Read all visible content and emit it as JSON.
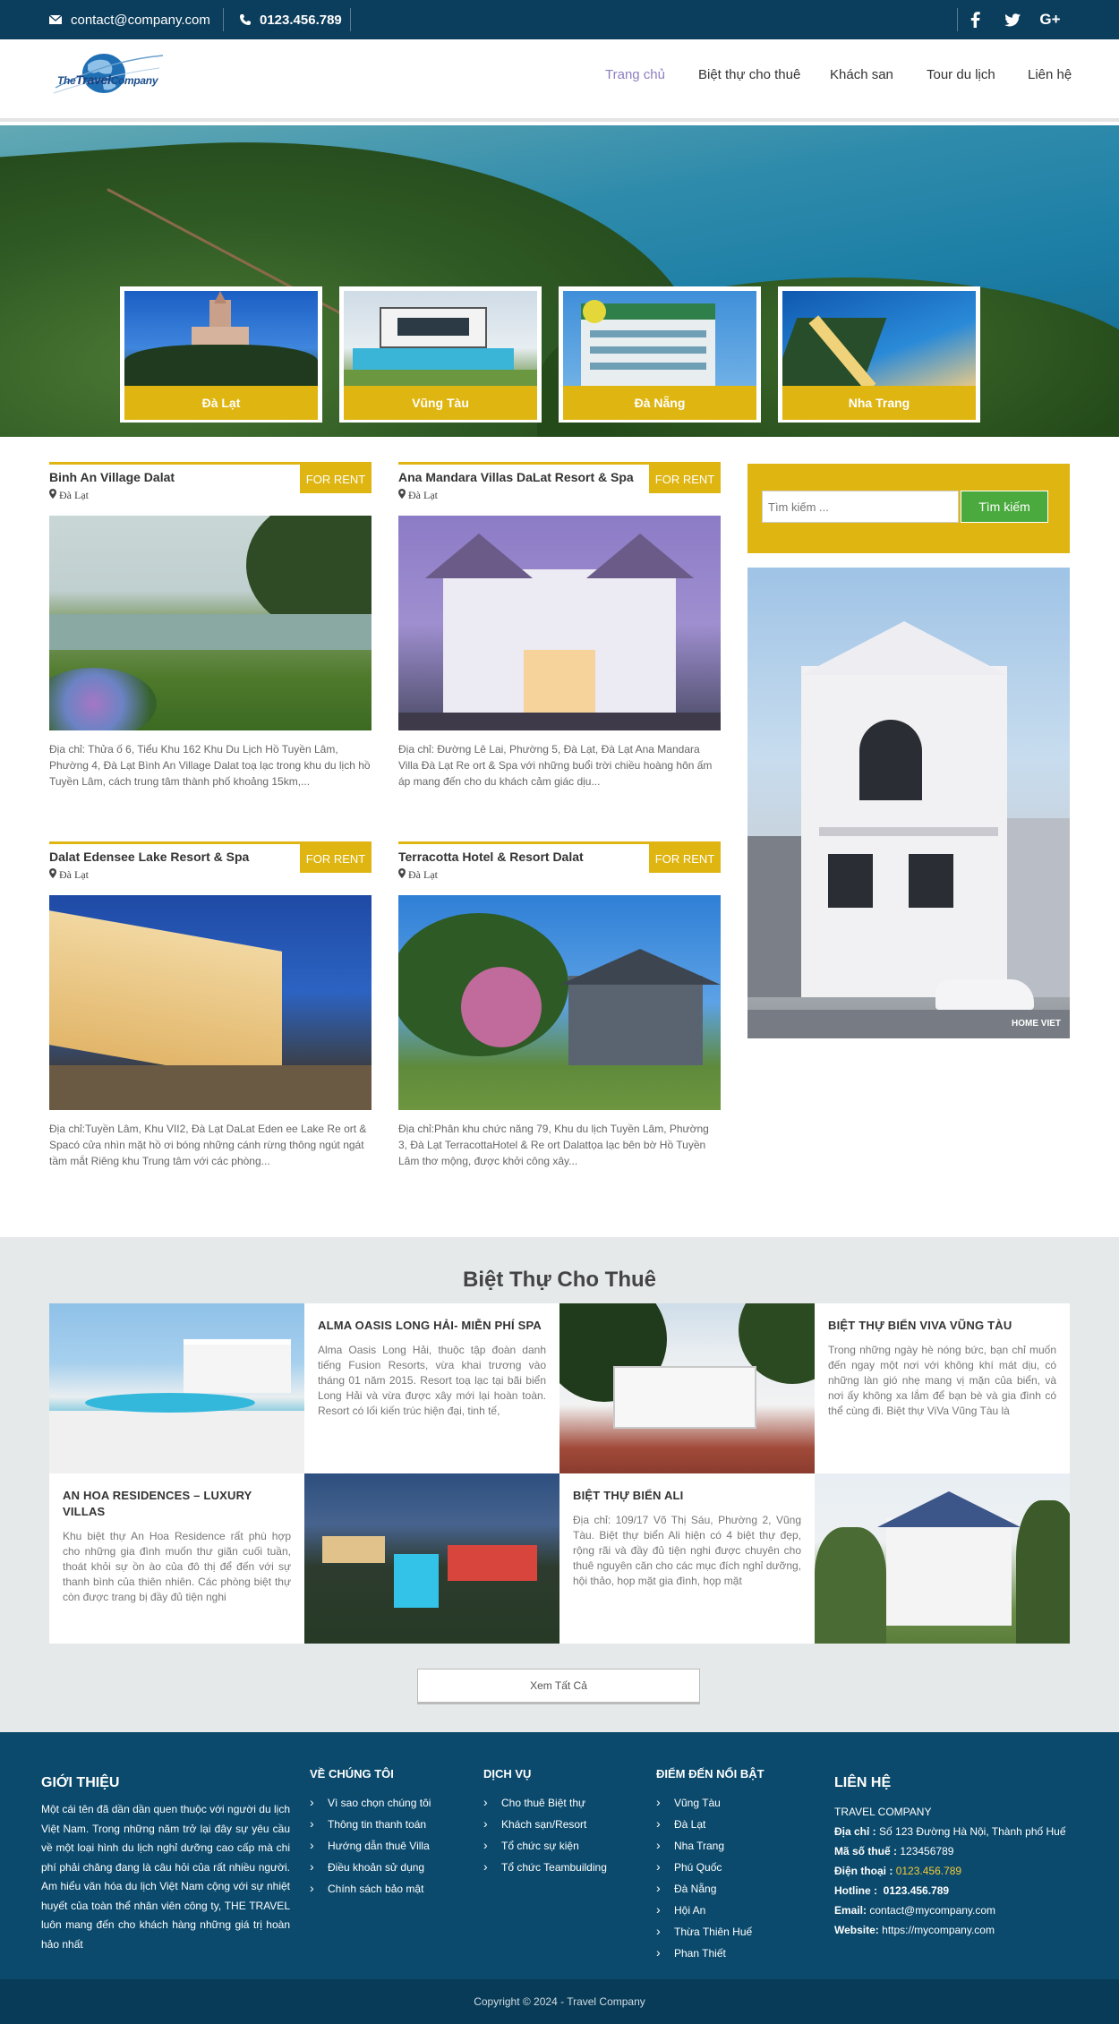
{
  "topbar": {
    "email": "contact@company.com",
    "phone": "0123.456.789",
    "social": {
      "facebook": "f",
      "twitter": "t",
      "google_plus": "G+"
    }
  },
  "header": {
    "logo_text_1": "The",
    "logo_text_2": "Travel",
    "logo_text_3": "Company",
    "nav": [
      "Trang chủ",
      "Biệt thự cho thuê",
      "Khách san",
      "Tour du lịch",
      "Liên hệ"
    ]
  },
  "destinations": [
    "Đà Lạt",
    "Vũng Tàu",
    "Đà Nẵng",
    "Nha Trang"
  ],
  "listings": [
    {
      "title": "Binh An Village Dalat",
      "location": "Đà Lạt",
      "badge": "FOR RENT",
      "desc": "Địa chỉ: Thửa ố 6, Tiểu Khu 162 Khu Du Lịch Hồ Tuyền Lâm, Phường 4, Đà Lạt Bình An Village Dalat toạ lạc trong khu du lịch hồ Tuyền Lâm, cách trung tâm thành phố khoảng 15km,..."
    },
    {
      "title": "Ana Mandara Villas DaLat Resort & Spa",
      "location": "Đà Lạt",
      "badge": "FOR RENT",
      "desc": "Địa chỉ: Đường Lê Lai, Phường 5, Đà Lạt, Đà Lạt Ana Mandara Villa Đà Lạt Re ort & Spa với những buổi trời chiều hoàng hôn ấm áp mang đến cho du khách cảm giác dịu..."
    },
    {
      "title": "Dalat Edensee Lake Resort & Spa",
      "location": "Đà Lạt",
      "badge": "FOR RENT",
      "desc": "Địa chỉ:Tuyền Lâm, Khu VII2, Đà Lạt DaLat Eden ee Lake Re ort & Spacó cửa nhìn mặt hồ ơi bóng những cánh rừng thông ngút ngát tầm mắt Riêng khu Trung tâm với các phòng..."
    },
    {
      "title": "Terracotta Hotel & Resort Dalat",
      "location": "Đà Lạt",
      "badge": "FOR RENT",
      "desc": "Địa chỉ:Phân khu chức năng 79, Khu du lịch Tuyền Lâm, Phường 3, Đà Lạt TerracottaHotel & Re ort Dalattọa lạc bên bờ Hồ Tuyền Lâm thơ mộng, được khởi công xây..."
    }
  ],
  "sidebar": {
    "search_placeholder": "Tìm kiếm ...",
    "search_button": "Tìm kiếm",
    "image_watermark": "HOME VIET"
  },
  "villas": {
    "title": "Biệt Thự Cho Thuê",
    "items": [
      {
        "title": "ALMA OASIS LONG HẢI- MIỄN PHÍ SPA",
        "desc": "Alma Oasis Long Hải, thuộc tập đoàn danh tiếng Fusion Resorts, vừa khai trương vào tháng 01 năm 2015. Resort toạ lạc tại bãi biển Long Hải và vừa được xây mới lại hoàn toàn. Resort có lối kiến trúc hiện đại, tinh tế,"
      },
      {
        "title": "BIỆT THỰ BIỂN VIVA VŨNG TÀU",
        "desc": "Trong những ngày hè nóng bức, bạn chỉ muốn đến ngay một nơi với không khí mát dịu, có những làn gió nhẹ mang vị mặn của biển, và nơi ấy không xa lắm để bạn bè và gia đình có thể cùng đi. Biệt thự ViVa Vũng Tàu là"
      },
      {
        "title": "AN HOA RESIDENCES – LUXURY VILLAS",
        "desc": "Khu biệt thự An Hoa Residence rất phù hợp cho những gia đình muốn thư giãn cuối tuần, thoát khỏi sự ồn ào của đô thị để đến với sự thanh bình của thiên nhiên. Các phòng biệt thự còn được trang bị đầy đủ tiện nghi"
      },
      {
        "title": "BIỆT THỰ BIỂN ALI",
        "desc": "Địa chỉ: 109/17 Võ Thị Sáu, Phường 2, Vũng Tàu. Biệt thự biển Ali hiện có 4 biệt thự đẹp, rộng rãi và đầy đủ tiện nghi được chuyên cho thuê nguyên căn cho các mục đích nghỉ dưỡng, hội thảo, họp mặt gia đình, họp mặt"
      }
    ],
    "view_all": "Xem Tất Cả"
  },
  "footer": {
    "intro_title": "GIỚI THIỆU",
    "intro_text": "Một cái tên đã dần dần quen thuộc với người du lịch Việt Nam. Trong những năm trở lại đây sự yêu cầu về một loại hình du lịch nghỉ dưỡng cao cấp mà chi phí phải chăng đang là câu hỏi của rất nhiều người. Am hiểu văn hóa du lịch Việt Nam cộng với sự nhiệt huyết của toàn thể nhân viên công ty, THE TRAVEL luôn mang đến cho khách hàng những giá trị hoàn hảo nhất",
    "about_title": "VỀ CHÚNG TÔI",
    "about_items": [
      "Vì sao chọn chúng tôi",
      "Thông tin thanh toán",
      "Hướng dẫn thuê Villa",
      "Điều khoản sử dụng",
      "Chính sách bảo mật"
    ],
    "service_title": "DỊCH VỤ",
    "service_items": [
      "Cho thuê Biệt thự",
      "Khách sạn/Resort",
      "Tổ chức sự kiện",
      "Tổ chức Teambuilding"
    ],
    "dest_title": "ĐIỂM ĐẾN NỔI BẬT",
    "dest_items": [
      "Vũng Tàu",
      "Đà Lạt",
      "Nha Trang",
      "Phú Quốc",
      "Đà Nẵng",
      "Hội An",
      "Thừa Thiên Huế",
      "Phan Thiết"
    ],
    "contact_title": "LIÊN HỆ",
    "company": "TRAVEL COMPANY",
    "address_label": "Địa chỉ :",
    "address": "Số 123 Đường Hà Nội, Thành phố Huế",
    "tax_label": "Mã số thuế :",
    "tax": "123456789",
    "phone_label": "Điện thoại :",
    "phone": "0123.456.789",
    "hotline_label": "Hotline :",
    "hotline": "0123.456.789",
    "email_label": "Email:",
    "email": "contact@mycompany.com",
    "website_label": "Website:",
    "website": "https://mycompany.com",
    "copyright": "Copyright © 2024 - Travel Company"
  },
  "colors": {
    "accent_yellow": "#dfb511",
    "navy": "#0b3d5c",
    "footer_blue": "#0b4a6c",
    "search_green": "#4aaa3e",
    "nav_active": "#8e7ec0"
  }
}
